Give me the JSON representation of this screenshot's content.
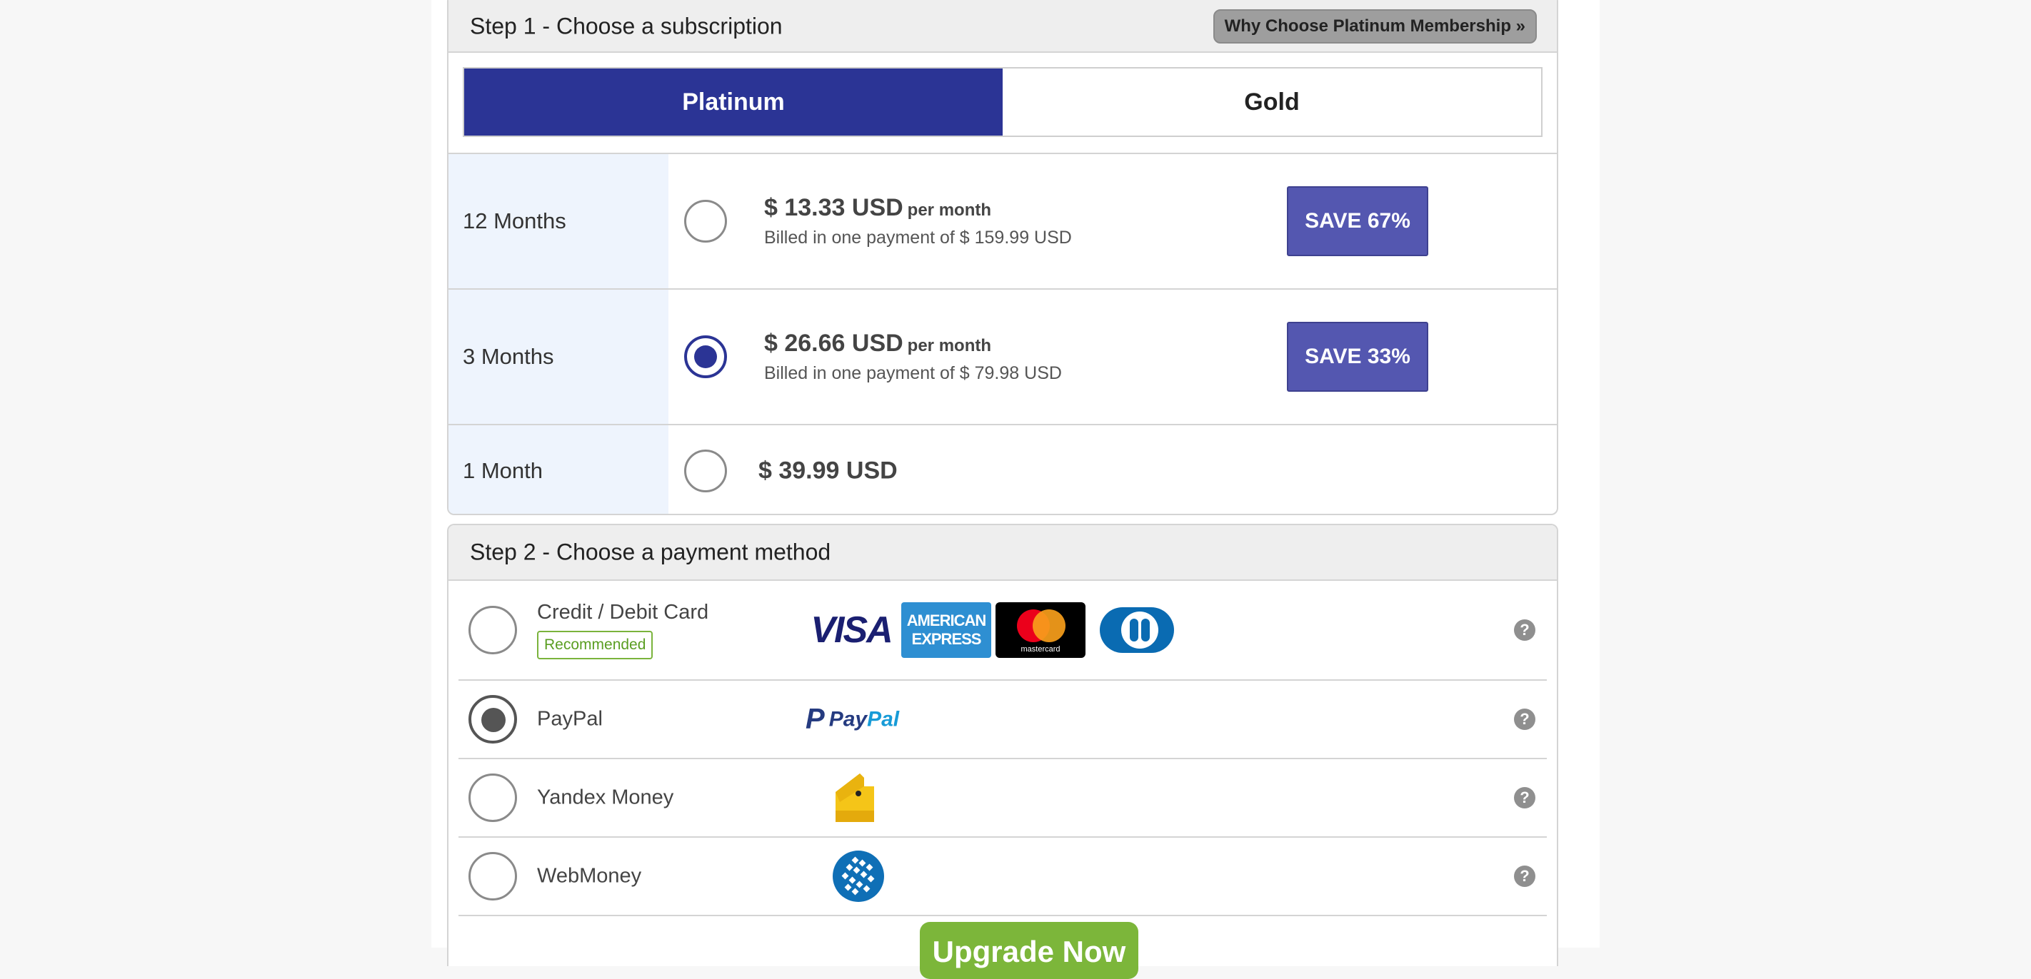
{
  "step1": {
    "title": "Step 1 - Choose a subscription",
    "why_button": "Why Choose Platinum Membership »",
    "tabs": [
      {
        "label": "Platinum",
        "active": true
      },
      {
        "label": "Gold",
        "active": false
      }
    ],
    "plans": [
      {
        "duration": "12 Months",
        "price": "$ 13.33 USD",
        "per": "per month",
        "billed": "Billed in one payment of $ 159.99 USD",
        "save": "SAVE 67%",
        "selected": false
      },
      {
        "duration": "3 Months",
        "price": "$ 26.66 USD",
        "per": "per month",
        "billed": "Billed in one payment of $ 79.98 USD",
        "save": "SAVE 33%",
        "selected": true
      },
      {
        "duration": "1 Month",
        "price": "$ 39.99 USD",
        "selected": false
      }
    ]
  },
  "step2": {
    "title": "Step 2 - Choose a payment method",
    "methods": [
      {
        "name": "Credit / Debit Card",
        "badge": "Recommended",
        "selected": false,
        "logos": [
          "visa-logo",
          "amex-logo",
          "mastercard-logo",
          "diners-club-logo"
        ]
      },
      {
        "name": "PayPal",
        "selected": true,
        "logos": [
          "paypal-logo"
        ]
      },
      {
        "name": "Yandex Money",
        "selected": false,
        "logos": [
          "yandex-money-logo"
        ]
      },
      {
        "name": "WebMoney",
        "selected": false,
        "logos": [
          "webmoney-logo"
        ]
      }
    ],
    "help_symbol": "?"
  },
  "logos": {
    "visa": "VISA",
    "amex_line1": "AMERICAN",
    "amex_line2": "EXPRESS",
    "mastercard": "mastercard",
    "paypal_pay": "Pay",
    "paypal_pal": "Pal",
    "paypal_p": "P"
  },
  "upgrade_button": "Upgrade Now",
  "colors": {
    "primary_blue": "#2b3495",
    "save_badge": "#5457b0",
    "upgrade_green": "#7cb63a",
    "recommended_green": "#5a9e22"
  }
}
